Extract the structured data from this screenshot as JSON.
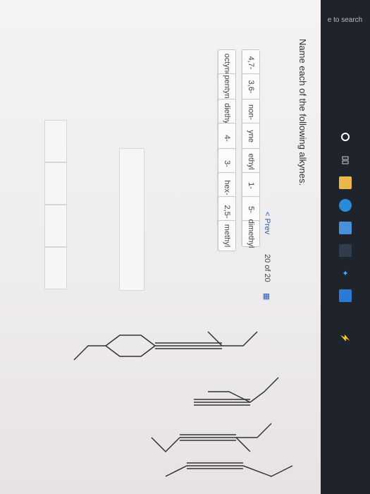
{
  "question": {
    "heading": "Name each of the following alkynes."
  },
  "word_bank": [
    {
      "label": "octyne"
    },
    {
      "label": "4,7-"
    },
    {
      "label": "pentyne"
    },
    {
      "label": "3,6-"
    },
    {
      "label": "diethyl"
    },
    {
      "label": "non-"
    },
    {
      "label": "4-"
    },
    {
      "label": "yne"
    },
    {
      "label": "3-"
    },
    {
      "label": "ethyl"
    },
    {
      "label": "hex-"
    },
    {
      "label": "1-"
    },
    {
      "label": "2,5-"
    },
    {
      "label": "5-"
    },
    {
      "label": "methyl"
    },
    {
      "label": "dimethyl"
    }
  ],
  "navigation": {
    "prev_label": "< Prev",
    "count_label": "20 of 20"
  },
  "taskbar": {
    "search_text": "e to search",
    "icons": [
      "cortana-icon",
      "task-view-icon",
      "file-explorer-icon",
      "edge-icon",
      "store-icon",
      "amazon-icon",
      "dropbox-icon",
      "mail-icon",
      "power-icon"
    ]
  },
  "colors": {
    "link": "#2a5fb0",
    "tile_border": "#c9c7c9",
    "taskbar": "#1f232b"
  }
}
